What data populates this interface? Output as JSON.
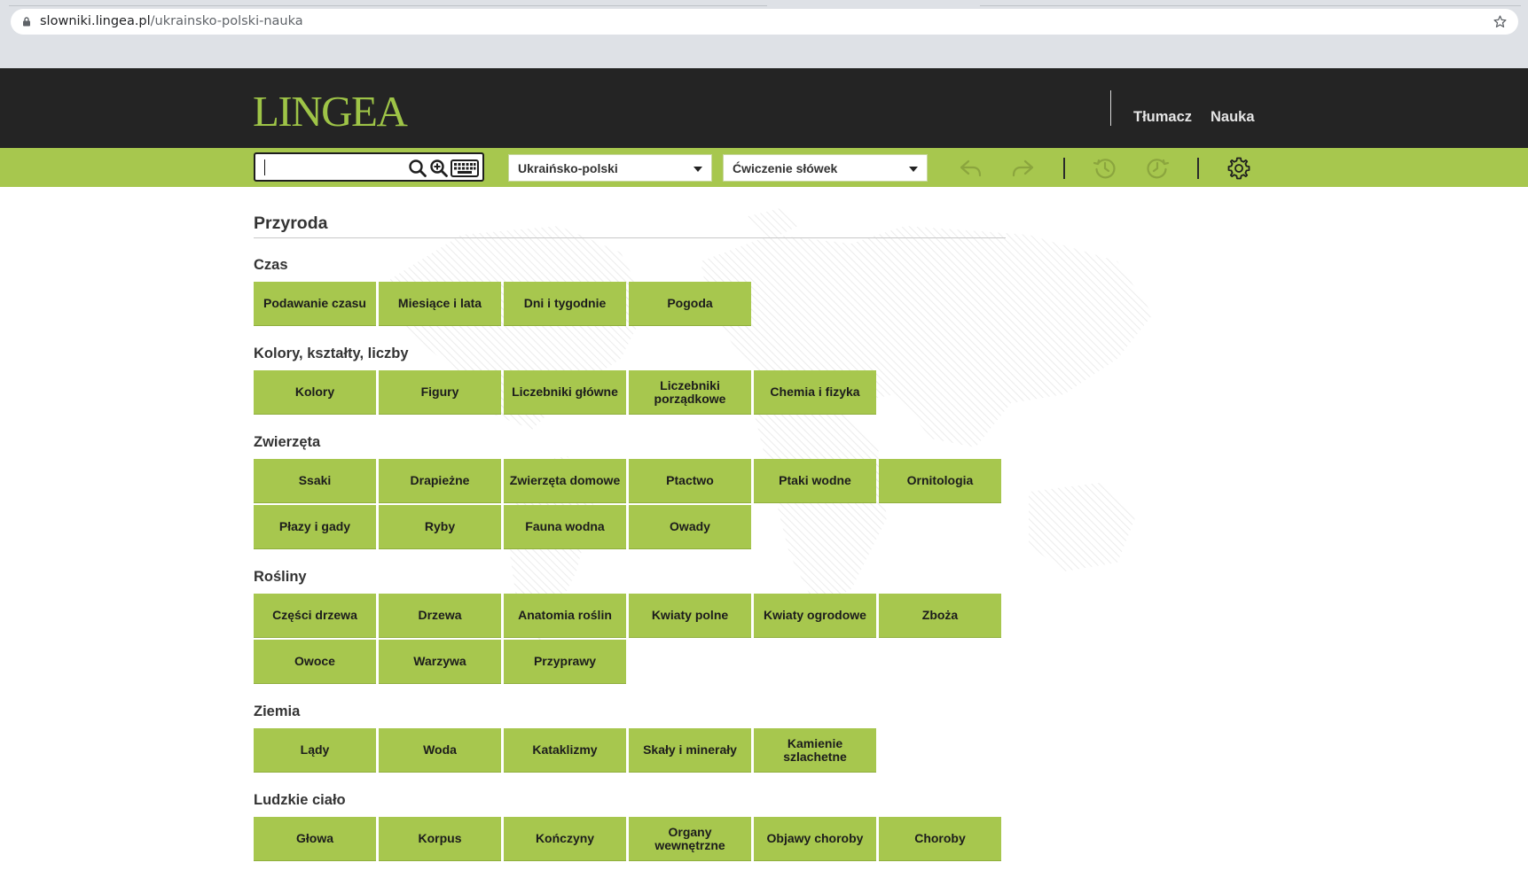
{
  "browser": {
    "url_host": "slowniki.lingea.pl",
    "url_path": "/ukrainsko-polski-nauka"
  },
  "header": {
    "logo": "LINGEA",
    "nav": [
      {
        "label": "Tłumacz"
      },
      {
        "label": "Nauka"
      }
    ]
  },
  "toolbar": {
    "search_value": "",
    "dictionary_select": "Ukraińsko-polski",
    "mode_select": "Ćwiczenie słówek"
  },
  "main": {
    "title": "Przyroda",
    "sections": [
      {
        "title": "Czas",
        "tiles": [
          "Podawanie czasu",
          "Miesiące i lata",
          "Dni i tygodnie",
          "Pogoda"
        ]
      },
      {
        "title": "Kolory, kształty, liczby",
        "tiles": [
          "Kolory",
          "Figury",
          "Liczebniki główne",
          "Liczebniki porządkowe",
          "Chemia i fizyka"
        ]
      },
      {
        "title": "Zwierzęta",
        "tiles": [
          "Ssaki",
          "Drapieżne",
          "Zwierzęta domowe",
          "Ptactwo",
          "Ptaki wodne",
          "Ornitologia",
          "Płazy i gady",
          "Ryby",
          "Fauna wodna",
          "Owady"
        ]
      },
      {
        "title": "Rośliny",
        "tiles": [
          "Części drzewa",
          "Drzewa",
          "Anatomia roślin",
          "Kwiaty polne",
          "Kwiaty ogrodowe",
          "Zboża",
          "Owoce",
          "Warzywa",
          "Przyprawy"
        ]
      },
      {
        "title": "Ziemia",
        "tiles": [
          "Lądy",
          "Woda",
          "Kataklizmy",
          "Skały i minerały",
          "Kamienie szlachetne"
        ]
      },
      {
        "title": "Ludzkie ciało",
        "tiles": [
          "Głowa",
          "Korpus",
          "Kończyny",
          "Organy wewnętrzne",
          "Objawy choroby",
          "Choroby"
        ]
      }
    ]
  }
}
